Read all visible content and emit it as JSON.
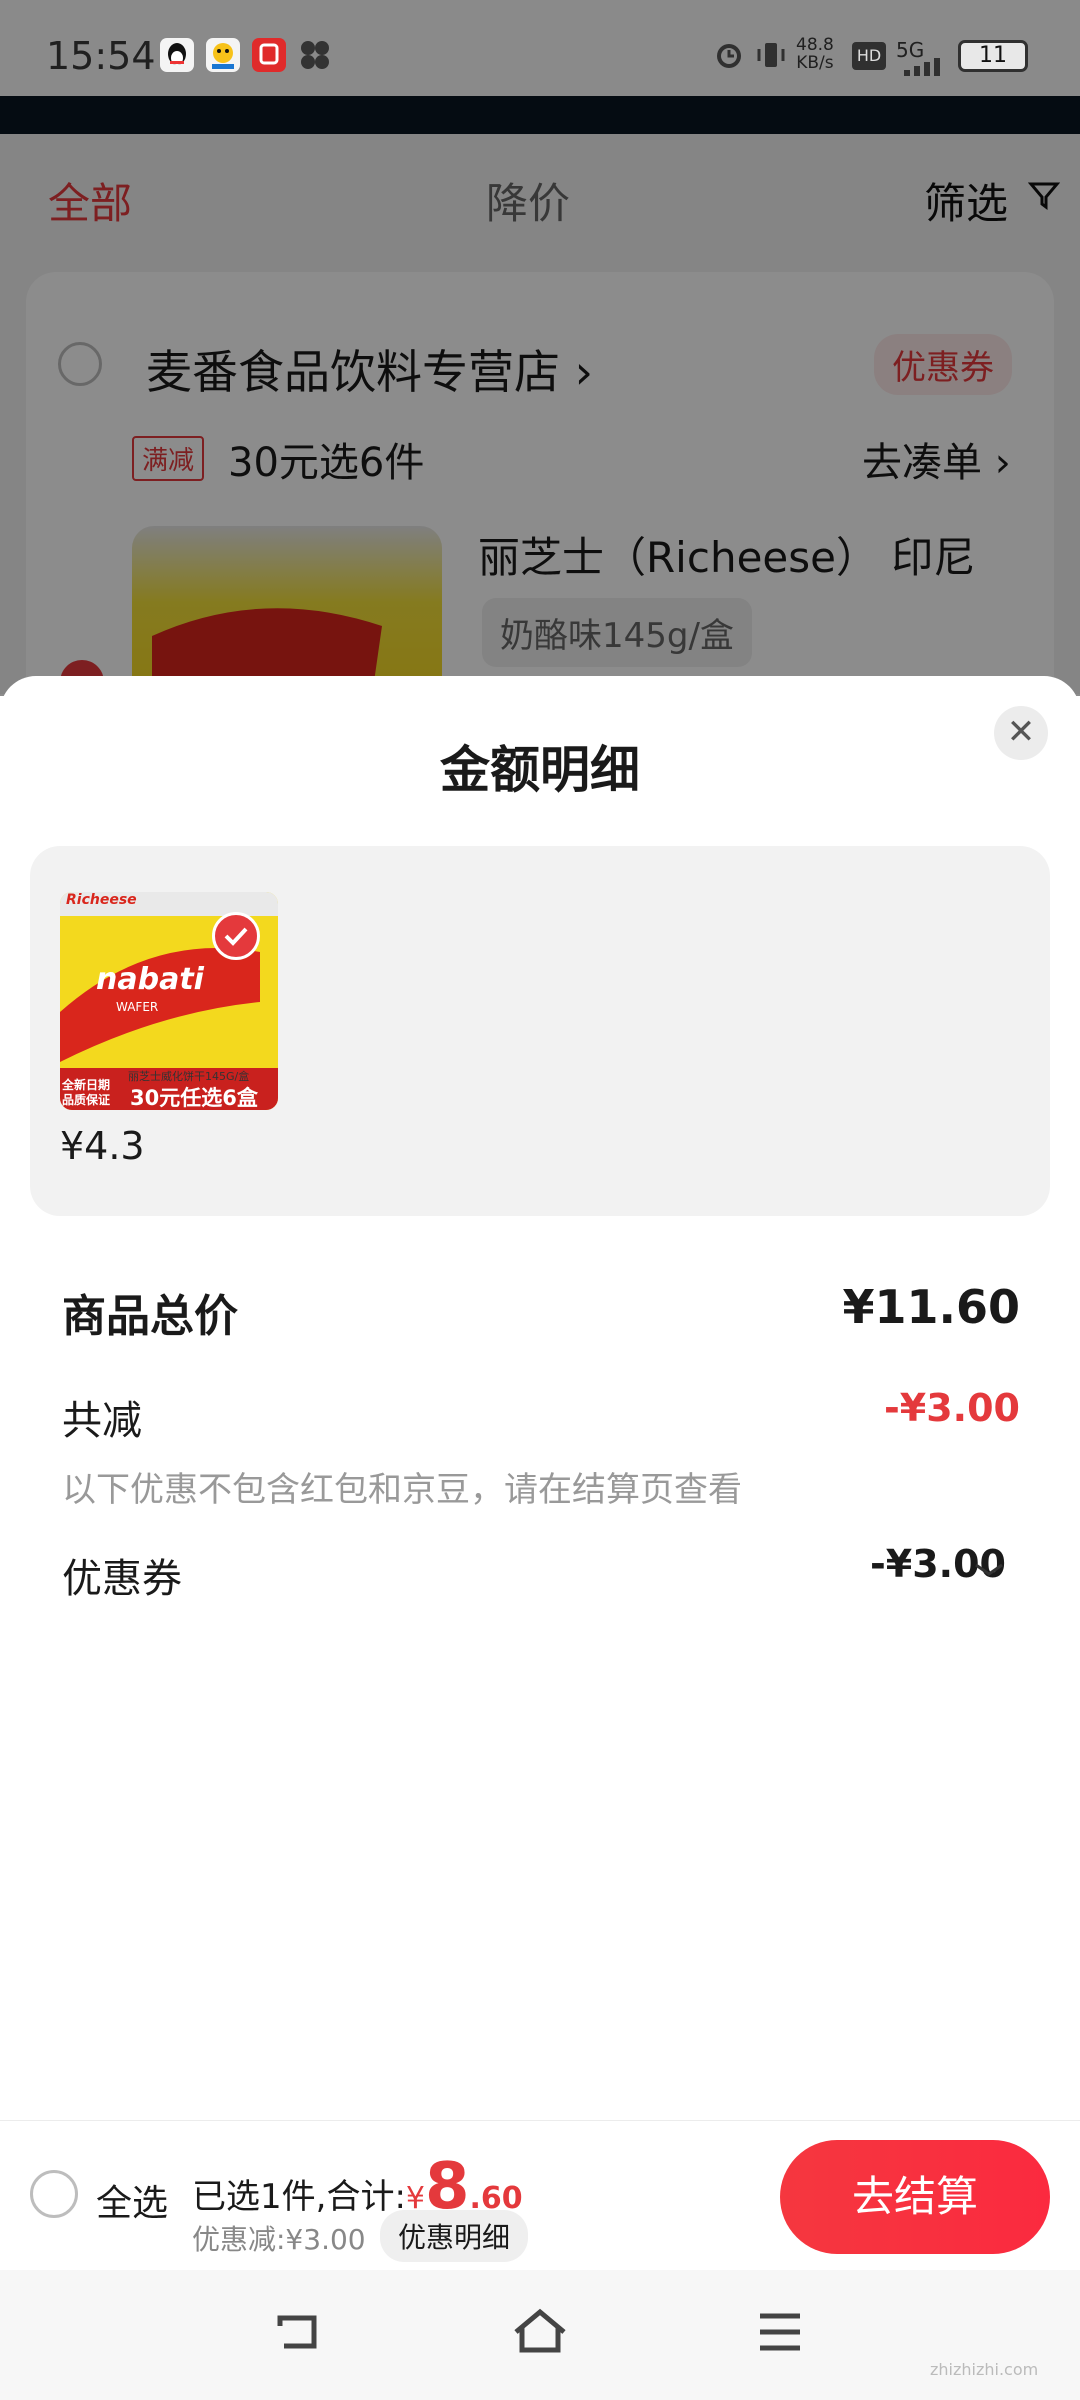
{
  "status_bar": {
    "time": "15:54",
    "net_speed_top": "48.8",
    "net_speed_bottom": "KB/s",
    "hd": "HD",
    "network": "5G",
    "battery": "11"
  },
  "background_page": {
    "tabs": [
      {
        "label": "全部",
        "active": true
      },
      {
        "label": "降价",
        "active": false
      },
      {
        "label": "筛选",
        "active": false
      }
    ],
    "store_name": "麦番食品饮料专营店",
    "store_arrow": "›",
    "coupon_tag": "优惠券",
    "promo_tag": "满减",
    "promo_text": "30元选6件",
    "promo_link": "去凑单 ›",
    "product_title": "丽芝士（Richeese） 印尼",
    "product_variant": "奶酪味145g/盒"
  },
  "sheet": {
    "title": "金额明细",
    "close_icon": "close-icon",
    "thumb_brand": "Richeese",
    "thumb_product": "nabati",
    "thumb_sub": "WAFER",
    "thumb_caption": "丽芝士威化饼干145G/盒",
    "thumb_badge_left": "全新日期 品质保证",
    "thumb_badge_right": "30元任选6盒",
    "item_price": "¥4.3",
    "total_label": "商品总价",
    "total_value": "¥11.60",
    "discount_label": "共减",
    "discount_value": "-¥3.00",
    "note": "以下优惠不包含红包和京豆，请在结算页查看",
    "coupon_label": "优惠券",
    "coupon_value": "-¥3.00"
  },
  "bottom_bar": {
    "select_all": "全选",
    "selected_text": "已选1件,合计:",
    "currency": "¥",
    "amount_int": "8",
    "amount_dec": ".60",
    "saved_text": "优惠减:¥3.00",
    "detail_button": "优惠明细",
    "checkout_button": "去结算"
  },
  "colors": {
    "accent_red": "#e4393c",
    "checkout_red": "#f5373f"
  },
  "watermark": "zhizhizhi.com"
}
